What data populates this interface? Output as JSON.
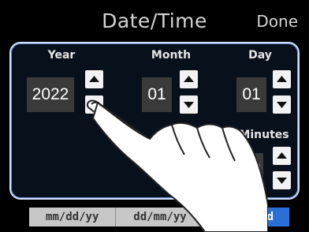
{
  "header": {
    "title": "Date/Time",
    "done_label": "Done"
  },
  "fields": {
    "year": {
      "label": "Year",
      "value": "2022"
    },
    "month": {
      "label": "Month",
      "value": "01"
    },
    "day": {
      "label": "Day",
      "value": "01"
    },
    "minutes": {
      "label": "Minutes",
      "value": "00"
    }
  },
  "formats": {
    "options": [
      "mm/dd/yy",
      "dd/mm/yy",
      "yy/mm/dd"
    ],
    "selected": "yy/mm/dd"
  },
  "colors": {
    "selected_format": "#2a6fd6",
    "panel_border": "#cfe0ff",
    "value_box": "#3a3a3a"
  },
  "icons": [
    "chevron-up-icon",
    "chevron-down-icon",
    "pointing-hand-icon"
  ]
}
